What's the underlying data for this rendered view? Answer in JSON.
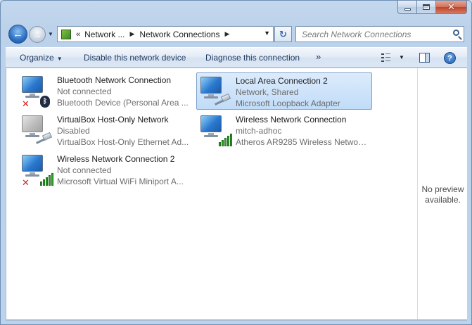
{
  "window": {
    "caption_buttons": {
      "minimize": "minimize",
      "maximize": "maximize",
      "close": "✕"
    }
  },
  "nav": {
    "back_glyph": "←",
    "forward_glyph": "→",
    "address": {
      "overflow": "«",
      "crumbs": [
        "Network ...",
        "Network Connections"
      ],
      "separator": "▶",
      "dropdown": "▼"
    },
    "refresh_glyph": "↻",
    "search": {
      "placeholder": "Search Network Connections",
      "value": ""
    }
  },
  "toolbar": {
    "organize": "Organize",
    "organize_caret": "▼",
    "disable": "Disable this network device",
    "diagnose": "Diagnose this connection",
    "more": "»",
    "view_caret": "▼",
    "help": "?"
  },
  "connections": [
    {
      "name": "Bluetooth Network Connection",
      "status": "Not connected",
      "device": "Bluetooth Device (Personal Area ...",
      "icon": "bluetooth-disconnected",
      "selected": false
    },
    {
      "name": "Local Area Connection 2",
      "status": "Network, Shared",
      "device": "Microsoft Loopback Adapter",
      "icon": "ethernet",
      "selected": true
    },
    {
      "name": "VirtualBox Host-Only Network",
      "status": "Disabled",
      "device": "VirtualBox Host-Only Ethernet Ad...",
      "icon": "ethernet-disabled",
      "selected": false
    },
    {
      "name": "Wireless Network Connection",
      "status": "mitch-adhoc",
      "device": "Atheros AR9285 Wireless Network...",
      "icon": "wireless",
      "selected": false
    },
    {
      "name": "Wireless Network Connection 2",
      "status": "Not connected",
      "device": "Microsoft Virtual WiFi Miniport A...",
      "icon": "wireless-disconnected",
      "selected": false
    }
  ],
  "preview": {
    "text": "No preview available."
  },
  "colors": {
    "selection": "#c1dcf8",
    "accent": "#1e3a5f",
    "error": "#d81e1e",
    "signal": "#2fa12b"
  }
}
